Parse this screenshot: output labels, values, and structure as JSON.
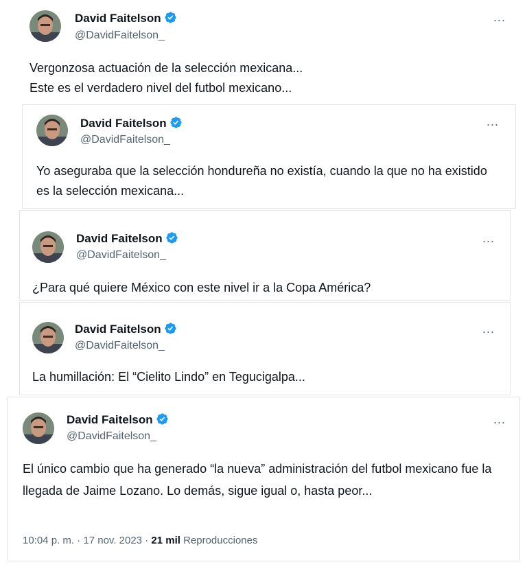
{
  "tweets": [
    {
      "name": "David Faitelson",
      "handle": "@DavidFaitelson_",
      "more": "...",
      "text": "Vergonzosa actuación de la selección mexicana...\nEste es el verdadero nivel del futbol mexicano..."
    },
    {
      "name": "David Faitelson",
      "handle": "@DavidFaitelson_",
      "more": "...",
      "text": "Yo aseguraba que la selección hondureña no existía, cuando la que no ha existido es la selección mexicana..."
    },
    {
      "name": "David Faitelson",
      "handle": "@DavidFaitelson_",
      "more": "...",
      "text": "¿Para qué quiere México con este nivel ir a la Copa América?"
    },
    {
      "name": "David Faitelson",
      "handle": "@DavidFaitelson_",
      "more": "...",
      "text": "La humillación: El “Cielito Lindo” en Tegucigalpa..."
    },
    {
      "name": "David Faitelson",
      "handle": "@DavidFaitelson_",
      "more": "...",
      "text": "El único cambio que ha generado “la nueva” administración del futbol mexicano fue la llegada de Jaime Lozano. Lo demás, sigue igual o, hasta peor..."
    }
  ],
  "footer": {
    "time": "10:04 p. m.",
    "sep1": " · ",
    "date": "17 nov. 2023",
    "sep2": " · ",
    "views_count": "21 mil",
    "views_label": "Reproducciones"
  },
  "colors": {
    "verified": "#1d9bf0",
    "secondary_text": "#536471",
    "primary_text": "#0f1419"
  },
  "icons": [
    "avatar",
    "verified-badge-icon",
    "more-options-icon"
  ]
}
